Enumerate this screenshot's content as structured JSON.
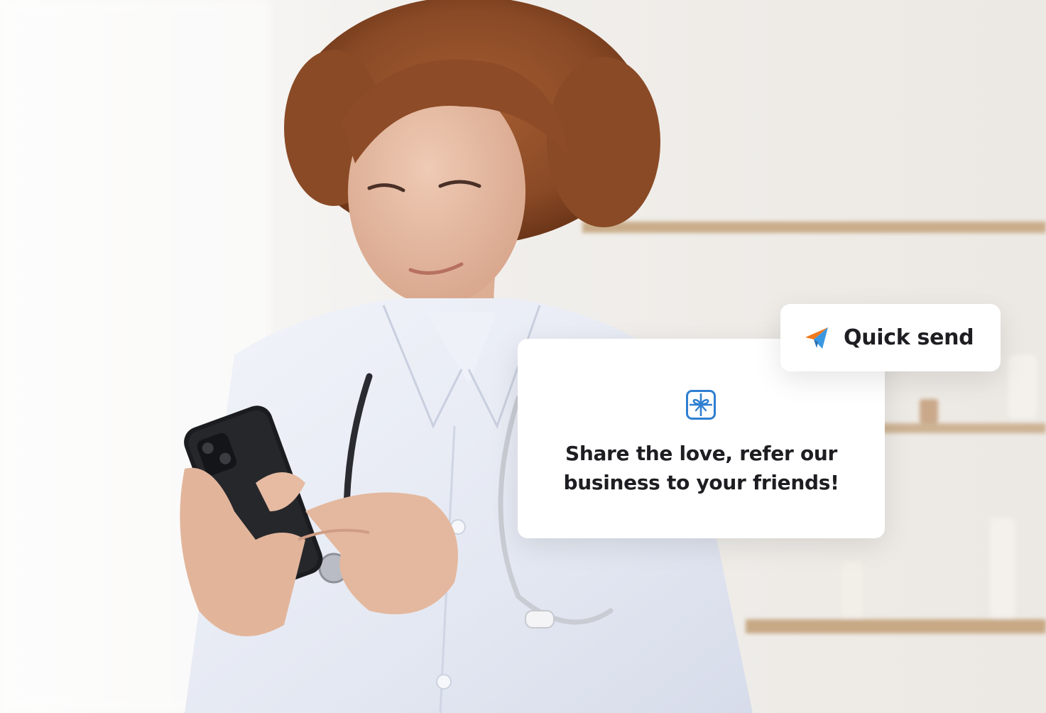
{
  "quick_send": {
    "label": "Quick send",
    "icon": "paper-plane-icon"
  },
  "referral_card": {
    "icon": "gift-icon",
    "message_line1": "Share the love, refer our",
    "message_line2": "business to your friends!"
  },
  "background": {
    "description_icon": "photo",
    "colors": {
      "wall": "#f3f2f0",
      "coat": "#e9edf6",
      "hair": "#8a4a26",
      "shelf": "#c9ad8a",
      "phone": "#1b1c1f"
    }
  },
  "colors": {
    "accent_blue": "#2f7fd1",
    "plane_orange": "#f07a1e",
    "plane_blue": "#3b98e0",
    "text": "#1e1e22"
  }
}
